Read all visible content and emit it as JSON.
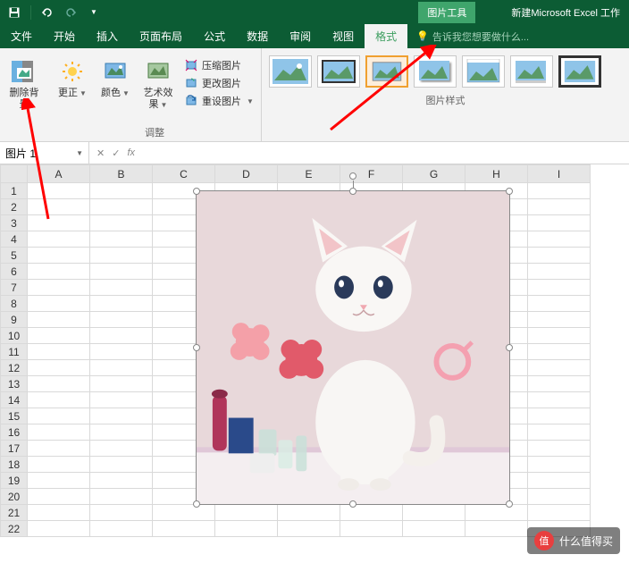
{
  "titlebar": {
    "context_tab": "图片工具",
    "doc_title": "新建Microsoft Excel 工作"
  },
  "menu": {
    "file": "文件",
    "home": "开始",
    "insert": "插入",
    "layout": "页面布局",
    "formula": "公式",
    "data": "数据",
    "review": "审阅",
    "view": "视图",
    "format": "格式",
    "tellme": "告诉我您想要做什么..."
  },
  "ribbon": {
    "removebg": "删除背景",
    "corrections": "更正",
    "color": "颜色",
    "effects": "艺术效果",
    "compress": "压缩图片",
    "change": "更改图片",
    "reset": "重设图片",
    "adjust_label": "调整",
    "styles_label": "图片样式"
  },
  "namebox": {
    "value": "图片 1",
    "fx": "fx"
  },
  "cols": [
    "A",
    "B",
    "C",
    "D",
    "E",
    "F",
    "G",
    "H",
    "I"
  ],
  "rows": [
    "1",
    "2",
    "3",
    "4",
    "5",
    "6",
    "7",
    "8",
    "9",
    "10",
    "11",
    "12",
    "13",
    "14",
    "15",
    "16",
    "17",
    "18",
    "19",
    "20",
    "21",
    "22"
  ],
  "watermark": {
    "badge": "值",
    "text": "什么值得买"
  }
}
